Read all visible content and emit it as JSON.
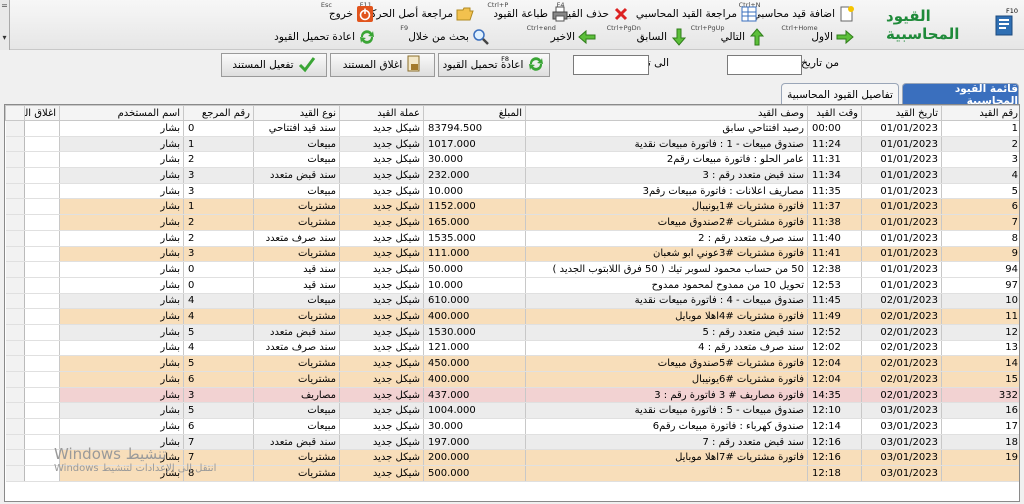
{
  "toolbar": {
    "strip_top": "=",
    "strip_bottom": "▾",
    "title": "القيود المحاسبية",
    "title_key": "F10",
    "buttons": [
      {
        "label": "اضافة قيد محاسبي",
        "key": "Ctrl+N"
      },
      {
        "label": "مراجعة القيد المحاسبي",
        "key": ""
      },
      {
        "label": "حذف القيد",
        "key": "F4"
      },
      {
        "label": "طباعة القيود",
        "key": "Ctrl+P"
      },
      {
        "label": "مراجعة أصل الحركة",
        "key": "F11"
      },
      {
        "label": "خروج",
        "key": "Esc"
      },
      {
        "label": "الاول",
        "key": "Ctrl+Home"
      },
      {
        "label": "التالي",
        "key": "Ctrl+PgUp"
      },
      {
        "label": "السابق",
        "key": "Ctrl+PgDn"
      },
      {
        "label": "الاخير",
        "key": "Ctrl+end"
      },
      {
        "label": "بحث من خلال",
        "key": "F9"
      },
      {
        "label": "اعادة تحميل القيود",
        "key": ""
      }
    ]
  },
  "filters": {
    "from_date_label": "من تاريخ",
    "from_date_value": "",
    "to_date_label": "الى تاريخ",
    "to_date_value": "",
    "reload_label": "اعادة تحميل القيود",
    "reload_key": "F8",
    "close_doc_label": "اغلاق المستند",
    "activate_doc_label": "تفعيل المستند"
  },
  "tabs": {
    "list": "قائمة القيود المحاسبية",
    "details": "تفاصيل القيود المحاسبية"
  },
  "grid": {
    "columns": [
      "رقم القيد",
      "تاريخ القيد",
      "وقت القيد",
      "وصف القيد",
      "المبلغ",
      "عملة القيد",
      "نوع القيد",
      "رقم المرجع",
      "اسم المستخدم",
      "اغلاق الحركة"
    ],
    "rows": [
      {
        "no": "1",
        "date": "01/01/2023",
        "time": "00:00",
        "desc": "رصيد افتتاحي سابق",
        "amount": "83794.500",
        "currency": "شيكل جديد",
        "type": "سند قيد افتتاحي",
        "ref": "0",
        "user": "بشار",
        "style": "white"
      },
      {
        "no": "2",
        "date": "01/01/2023",
        "time": "11:24",
        "desc": "صندوق مبيعات - 1 : فاتورة مبيعات نقدية",
        "amount": "1017.000",
        "currency": "شيكل جديد",
        "type": "مبيعات",
        "ref": "1",
        "user": "بشار",
        "style": "grey"
      },
      {
        "no": "3",
        "date": "01/01/2023",
        "time": "11:31",
        "desc": "عامر الحلو : فاتورة مبيعات رقم2",
        "amount": "30.000",
        "currency": "شيكل جديد",
        "type": "مبيعات",
        "ref": "2",
        "user": "بشار",
        "style": "white"
      },
      {
        "no": "4",
        "date": "01/01/2023",
        "time": "11:34",
        "desc": "سند قبض متعدد رقم : 3",
        "amount": "232.000",
        "currency": "شيكل جديد",
        "type": "سند قبض متعدد",
        "ref": "3",
        "user": "بشار",
        "style": "grey"
      },
      {
        "no": "5",
        "date": "01/01/2023",
        "time": "11:35",
        "desc": "مصاريف اعلانات : فاتورة مبيعات رقم3",
        "amount": "10.000",
        "currency": "شيكل جديد",
        "type": "مبيعات",
        "ref": "3",
        "user": "بشار",
        "style": "white"
      },
      {
        "no": "6",
        "date": "01/01/2023",
        "time": "11:37",
        "desc": "فاتورة مشتريات #1يونيبال",
        "amount": "1152.000",
        "currency": "شيكل جديد",
        "type": "مشتريات",
        "ref": "1",
        "user": "بشار",
        "style": "orange"
      },
      {
        "no": "7",
        "date": "01/01/2023",
        "time": "11:38",
        "desc": "فاتورة مشتريات #2صندوق مبيعات",
        "amount": "165.000",
        "currency": "شيكل جديد",
        "type": "مشتريات",
        "ref": "2",
        "user": "بشار",
        "style": "orange"
      },
      {
        "no": "8",
        "date": "01/01/2023",
        "time": "11:40",
        "desc": "سند صرف متعدد رقم : 2",
        "amount": "1535.000",
        "currency": "شيكل جديد",
        "type": "سند صرف متعدد",
        "ref": "2",
        "user": "بشار",
        "style": "white"
      },
      {
        "no": "9",
        "date": "01/01/2023",
        "time": "11:41",
        "desc": "فاتورة مشتريات #3عوني ابو شعبان",
        "amount": "111.000",
        "currency": "شيكل جديد",
        "type": "مشتريات",
        "ref": "3",
        "user": "بشار",
        "style": "orange"
      },
      {
        "no": "94",
        "date": "01/01/2023",
        "time": "12:38",
        "desc": "50 من حساب محمود لسوبر تيك ( 50 فرق اللابتوب الجديد )",
        "amount": "50.000",
        "currency": "شيكل جديد",
        "type": "سند قيد",
        "ref": "0",
        "user": "بشار",
        "style": "white"
      },
      {
        "no": "97",
        "date": "01/01/2023",
        "time": "12:53",
        "desc": "تحويل 10 من ممدوح لمحمود ممدوح",
        "amount": "10.000",
        "currency": "شيكل جديد",
        "type": "سند قيد",
        "ref": "0",
        "user": "بشار",
        "style": "white"
      },
      {
        "no": "10",
        "date": "02/01/2023",
        "time": "11:45",
        "desc": "صندوق مبيعات - 4 : فاتورة مبيعات نقدية",
        "amount": "610.000",
        "currency": "شيكل جديد",
        "type": "مبيعات",
        "ref": "4",
        "user": "بشار",
        "style": "grey"
      },
      {
        "no": "11",
        "date": "02/01/2023",
        "time": "11:49",
        "desc": "فاتورة مشتريات #4اهلا موبايل",
        "amount": "400.000",
        "currency": "شيكل جديد",
        "type": "مشتريات",
        "ref": "4",
        "user": "بشار",
        "style": "orange"
      },
      {
        "no": "12",
        "date": "02/01/2023",
        "time": "12:52",
        "desc": "سند قبض متعدد رقم : 5",
        "amount": "1530.000",
        "currency": "شيكل جديد",
        "type": "سند قبض متعدد",
        "ref": "5",
        "user": "بشار",
        "style": "grey"
      },
      {
        "no": "13",
        "date": "02/01/2023",
        "time": "12:02",
        "desc": "سند صرف متعدد رقم : 4",
        "amount": "121.000",
        "currency": "شيكل جديد",
        "type": "سند صرف متعدد",
        "ref": "4",
        "user": "بشار",
        "style": "white"
      },
      {
        "no": "14",
        "date": "02/01/2023",
        "time": "12:04",
        "desc": "فاتورة مشتريات #5صندوق مبيعات",
        "amount": "450.000",
        "currency": "شيكل جديد",
        "type": "مشتريات",
        "ref": "5",
        "user": "بشار",
        "style": "orange"
      },
      {
        "no": "15",
        "date": "02/01/2023",
        "time": "12:04",
        "desc": "فاتورة مشتريات #6يونيبال",
        "amount": "400.000",
        "currency": "شيكل جديد",
        "type": "مشتريات",
        "ref": "6",
        "user": "بشار",
        "style": "orange"
      },
      {
        "no": "332",
        "date": "02/01/2023",
        "time": "14:35",
        "desc": "فاتورة مصاريف # 3 فاتورة رقم : 3",
        "amount": "437.000",
        "currency": "شيكل جديد",
        "type": "مصاريف",
        "ref": "3",
        "user": "بشار",
        "style": "pink"
      },
      {
        "no": "16",
        "date": "03/01/2023",
        "time": "12:10",
        "desc": "صندوق مبيعات - 5 : فاتورة مبيعات نقدية",
        "amount": "1004.000",
        "currency": "شيكل جديد",
        "type": "مبيعات",
        "ref": "5",
        "user": "بشار",
        "style": "grey"
      },
      {
        "no": "17",
        "date": "03/01/2023",
        "time": "12:14",
        "desc": "صندوق كهرباء : فاتورة مبيعات رقم6",
        "amount": "30.000",
        "currency": "شيكل جديد",
        "type": "مبيعات",
        "ref": "6",
        "user": "بشار",
        "style": "white"
      },
      {
        "no": "18",
        "date": "03/01/2023",
        "time": "12:16",
        "desc": "سند قبض متعدد رقم : 7",
        "amount": "197.000",
        "currency": "شيكل جديد",
        "type": "سند قبض متعدد",
        "ref": "7",
        "user": "بشار",
        "style": "grey"
      },
      {
        "no": "19",
        "date": "03/01/2023",
        "time": "12:16",
        "desc": "فاتورة مشتريات #7اهلا موبايل",
        "amount": "200.000",
        "currency": "شيكل جديد",
        "type": "مشتريات",
        "ref": "7",
        "user": "بشار",
        "style": "orange"
      },
      {
        "no": "",
        "date": "03/01/2023",
        "time": "12:18",
        "desc": "",
        "amount": "500.000",
        "currency": "شيكل جديد",
        "type": "مشتريات",
        "ref": "8",
        "user": "بشار",
        "style": "orange"
      }
    ]
  },
  "watermark": {
    "line1": "تنشيط Windows",
    "line2": "انتقل إلى الإعدادات لتنشيط Windows"
  },
  "colors": {
    "title_green": "#1f8a3a",
    "tab_active": "#3a6fbe",
    "row_orange": "#f8deba",
    "row_pink": "#f2d2d2",
    "row_grey": "#ececec"
  }
}
